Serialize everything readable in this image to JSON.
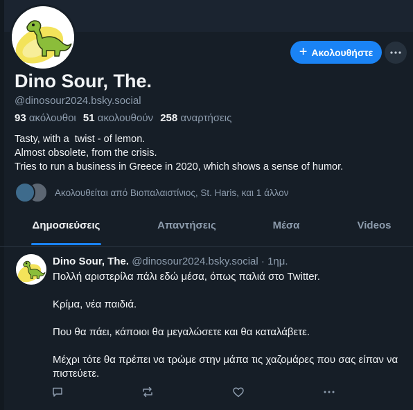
{
  "profile": {
    "display_name": "Dino Sour, The.",
    "handle": "@dinosour2024.bsky.social",
    "follow_button": "Ακολουθήστε",
    "stats": {
      "following_count": "93",
      "following_label": "ακόλουθοι",
      "followers_count": "51",
      "followers_label": "ακολουθούν",
      "posts_count": "258",
      "posts_label": "αναρτήσεις"
    },
    "bio": [
      "Tasty, with a  twist - of lemon.",
      "Almost obsolete, from the crisis.",
      "Tries to run a business in Greece in 2020, which shows a sense of humor."
    ],
    "followed_by": "Ακολουθείται από Βιοπαλαιστίνιος, St. Haris, και 1 άλλον"
  },
  "tabs": [
    {
      "label": "Δημοσιεύσεις",
      "active": true
    },
    {
      "label": "Απαντήσεις",
      "active": false
    },
    {
      "label": "Μέσα",
      "active": false
    },
    {
      "label": "Videos",
      "active": false
    }
  ],
  "post": {
    "author": "Dino Sour, The.",
    "handle": "@dinosour2024.bsky.social",
    "time": "· 1ημ.",
    "paragraphs": [
      "Πολλή αριστερίλα πάλι εδώ μέσα, όπως παλιά στο Twitter.",
      "Κρίμα, νέα παιδιά.",
      "Που θα πάει, κάποιοι θα μεγαλώσετε και θα καταλάβετε.",
      "Μέχρι τότε θα πρέπει να τρώμε στην μάπα τις χαζομάρες που σας είπαν να πιστεύετε."
    ]
  },
  "colors": {
    "background": "#161e27",
    "accent": "#1a83f5",
    "muted_text": "#8d9cad"
  },
  "icons": [
    "plus-icon",
    "ellipsis-icon",
    "reply-icon",
    "repost-icon",
    "like-icon",
    "more-icon"
  ]
}
